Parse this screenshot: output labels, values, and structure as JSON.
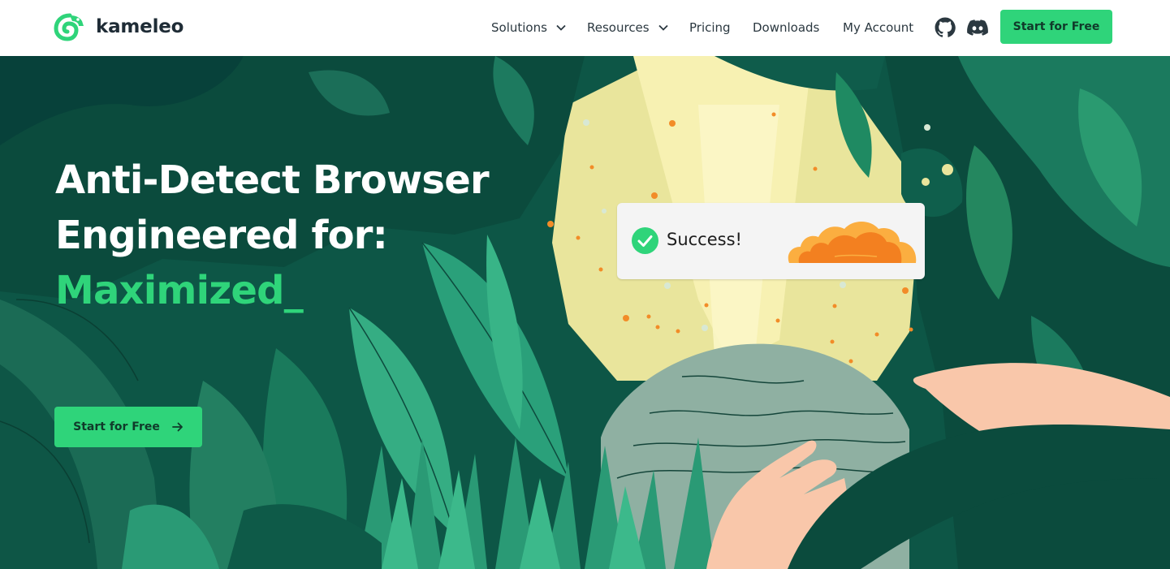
{
  "brand": {
    "name": "kameleo",
    "color": "#2fd47a"
  },
  "nav": {
    "solutions": "Solutions",
    "resources": "Resources",
    "pricing": "Pricing",
    "downloads": "Downloads",
    "account": "My Account",
    "github_icon": "github-icon",
    "discord_icon": "discord-icon",
    "cta": "Start for Free"
  },
  "hero": {
    "line1": "Anti-Detect Browser",
    "line2": "Engineered for:",
    "line3": "Maximized_",
    "cta": "Start for Free",
    "card": {
      "status": "Success!",
      "status_icon": "check-circle-icon",
      "logo_icon": "cloudflare-cloud-icon"
    }
  }
}
